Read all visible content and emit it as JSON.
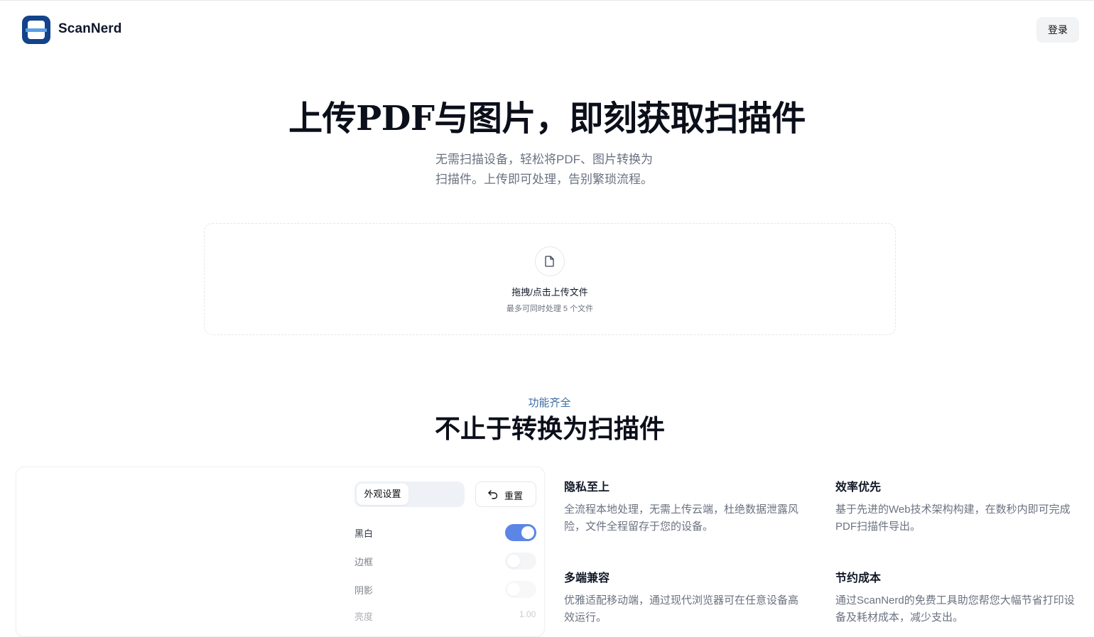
{
  "header": {
    "brand": "ScanNerd",
    "login_label": "登录"
  },
  "hero": {
    "title": "上传PDF与图片，即刻获取扫描件",
    "subtitle_line1": "无需扫描设备，轻松将PDF、图片转换为",
    "subtitle_line2": "扫描件。上传即可处理，告别繁琐流程。"
  },
  "upload": {
    "title": "拖拽/点击上传文件",
    "hint": "最多可同时处理 5 个文件",
    "icon": "file-icon"
  },
  "features": {
    "eyebrow": "功能齐全",
    "title": "不止于转换为扫描件",
    "items": [
      {
        "title": "隐私至上",
        "desc": "全流程本地处理，无需上传云端，杜绝数据泄露风险，文件全程留存于您的设备。"
      },
      {
        "title": "效率优先",
        "desc": "基于先进的Web技术架构构建，在数秒内即可完成PDF扫描件导出。"
      },
      {
        "title": "多端兼容",
        "desc": "优雅适配移动端，通过现代浏览器可在任意设备高效运行。"
      },
      {
        "title": "节约成本",
        "desc": "通过ScanNerd的免费工具助您帮您大幅节省打印设备及耗材成本，减少支出。"
      }
    ]
  },
  "settings": {
    "tab_label": "外观设置",
    "reset_label": "重置",
    "options": [
      {
        "label": "黑白",
        "on": true
      },
      {
        "label": "边框",
        "on": false
      },
      {
        "label": "阴影",
        "on": false
      }
    ],
    "brightness_label": "亮度",
    "brightness_value": "1.00"
  },
  "colors": {
    "brand": "#13438a",
    "accent": "#5b86e5",
    "eyebrow": "#3b6ea5"
  }
}
